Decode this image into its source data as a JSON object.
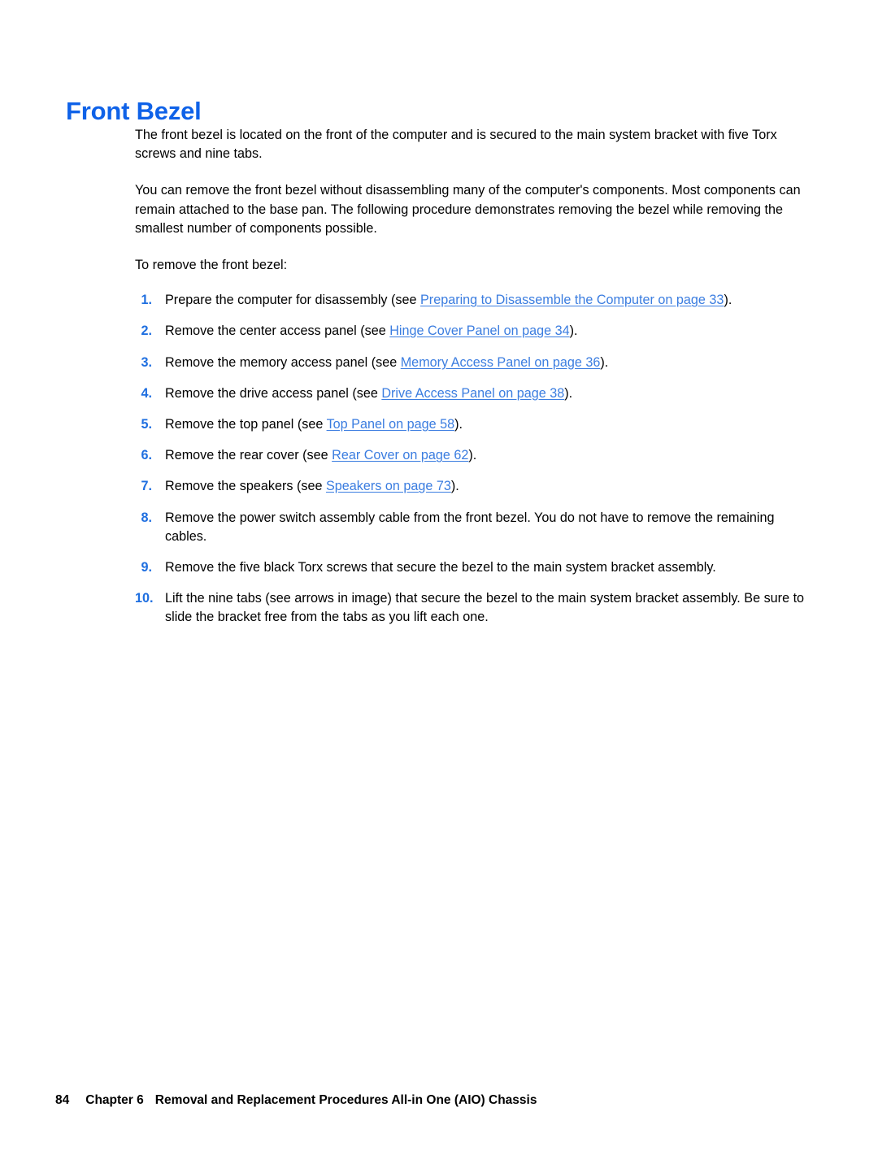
{
  "document": {
    "heading": "Front Bezel",
    "heading_color": "#0F62E8",
    "link_color": "#3B7DE0",
    "number_color": "#1F6FE0"
  },
  "paragraphs": [
    "The front bezel is located on the front of the computer and is secured to the main system bracket with five Torx screws and nine tabs.",
    "You can remove the front bezel without disassembling many of the computer's components. Most components can remain attached to the base pan. The following procedure demonstrates removing the bezel while removing the smallest number of components possible.",
    "To remove the front bezel:"
  ],
  "steps": [
    {
      "number": "1.",
      "before": "Prepare the computer for disassembly (see ",
      "link": "Preparing to Disassemble the Computer on page 33",
      "after": ")."
    },
    {
      "number": "2.",
      "before": "Remove the center access panel (see ",
      "link": "Hinge Cover Panel on page 34",
      "after": ")."
    },
    {
      "number": "3.",
      "before": "Remove the memory access panel (see ",
      "link": "Memory Access Panel on page 36",
      "after": ")."
    },
    {
      "number": "4.",
      "before": "Remove the drive access panel (see ",
      "link": "Drive Access Panel on page 38",
      "after": ")."
    },
    {
      "number": "5.",
      "before": "Remove the top panel (see ",
      "link": "Top Panel on page 58",
      "after": ")."
    },
    {
      "number": "6.",
      "before": "Remove the rear cover (see ",
      "link": "Rear Cover on page 62",
      "after": ")."
    },
    {
      "number": "7.",
      "before": "Remove the speakers (see ",
      "link": "Speakers on page 73",
      "after": ")."
    },
    {
      "number": "8.",
      "before": "Remove the power switch assembly cable from the front bezel. You do not have to remove the remaining cables.",
      "link": "",
      "after": ""
    },
    {
      "number": "9.",
      "before": "Remove the five black Torx screws that secure the bezel to the main system bracket assembly.",
      "link": "",
      "after": ""
    },
    {
      "number": "10.",
      "before": "Lift the nine tabs (see arrows in image) that secure the bezel to the main system bracket assembly. Be sure to slide the bracket free from the tabs as you lift each one.",
      "link": "",
      "after": ""
    }
  ],
  "footer": {
    "page_number": "84",
    "chapter": "Chapter 6",
    "title": "Removal and Replacement Procedures All-in One (AIO) Chassis"
  }
}
